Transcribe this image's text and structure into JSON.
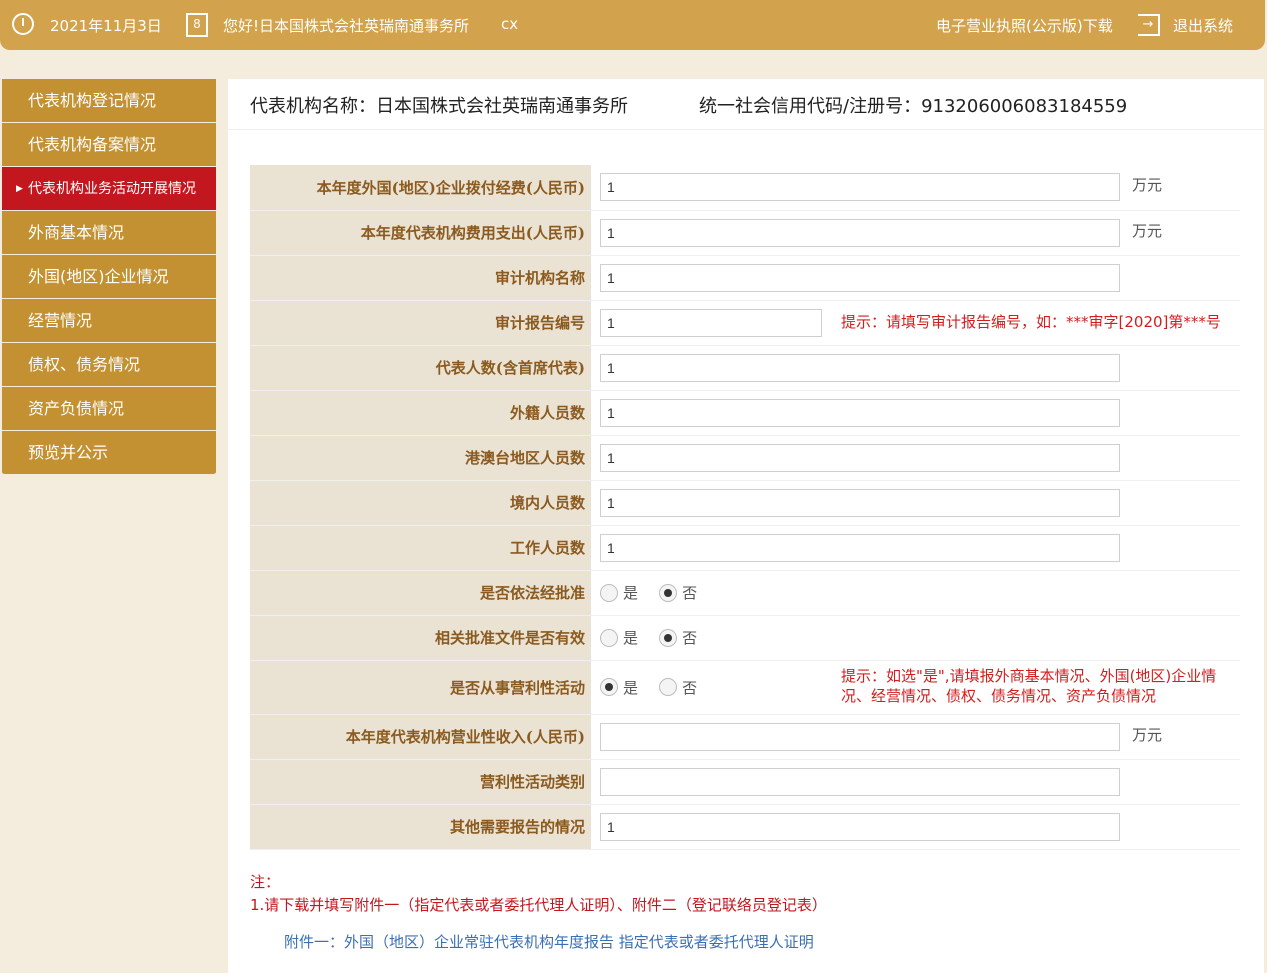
{
  "topbar": {
    "date": "2021年11月3日",
    "greeting": "您好!日本国株式会社英瑞南通事务所",
    "username": "cx",
    "download_license": "电子营业执照(公示版)下载",
    "logout": "退出系统",
    "user_icon_glyph": "8"
  },
  "sidebar": {
    "items": [
      {
        "label": "代表机构登记情况"
      },
      {
        "label": "代表机构备案情况"
      },
      {
        "label": "代表机构业务活动开展情况"
      },
      {
        "label": "外商基本情况"
      },
      {
        "label": "外国(地区)企业情况"
      },
      {
        "label": "经营情况"
      },
      {
        "label": "债权、债务情况"
      },
      {
        "label": "资产负债情况"
      },
      {
        "label": "预览并公示"
      }
    ],
    "active_index": 2
  },
  "header": {
    "name": "代表机构名称：日本国株式会社英瑞南通事务所",
    "code": "统一社会信用代码/注册号：913206006083184559"
  },
  "form": {
    "rows": [
      {
        "label": "本年度外国(地区)企业拨付经费(人民币)",
        "value": "1",
        "unit": "万元"
      },
      {
        "label": "本年度代表机构费用支出(人民币)",
        "value": "1",
        "unit": "万元"
      },
      {
        "label": "审计机构名称",
        "value": "1"
      },
      {
        "label": "审计报告编号",
        "value": "1",
        "hint": "提示：请填写审计报告编号，如：***审字[2020]第***号"
      },
      {
        "label": "代表人数(含首席代表)",
        "value": "1"
      },
      {
        "label": "外籍人员数",
        "value": "1"
      },
      {
        "label": "港澳台地区人员数",
        "value": "1"
      },
      {
        "label": "境内人员数",
        "value": "1"
      },
      {
        "label": "工作人员数",
        "value": "1"
      },
      {
        "label": "是否依法经批准",
        "yes": "是",
        "no": "否",
        "selected": "否"
      },
      {
        "label": "相关批准文件是否有效",
        "yes": "是",
        "no": "否",
        "selected": "否"
      },
      {
        "label": "是否从事营利性活动",
        "yes": "是",
        "no": "否",
        "selected": "是",
        "hint_line1": "提示：如选\"是\",请填报外商基本情况、外国(地区)企业情",
        "hint_line2": "况、经营情况、债权、债务情况、资产负债情况"
      },
      {
        "label": "本年度代表机构营业性收入(人民币)",
        "value": "",
        "unit": "万元"
      },
      {
        "label": "营利性活动类别",
        "value": ""
      },
      {
        "label": "其他需要报告的情况",
        "value": "1"
      }
    ]
  },
  "notes": {
    "title": "注：",
    "line1": "1.请下载并填写附件一（指定代表或者委托代理人证明）、附件二（登记联络员登记表）",
    "attachment1": "附件一：外国（地区）企业常驻代表机构年度报告 指定代表或者委托代理人证明"
  },
  "colors": {
    "topbar": "#d2a24c",
    "sidebar": "#c39132",
    "sidebar_active": "#c3171f",
    "label_bg": "#eae2d3",
    "hint": "#d11f1f"
  }
}
